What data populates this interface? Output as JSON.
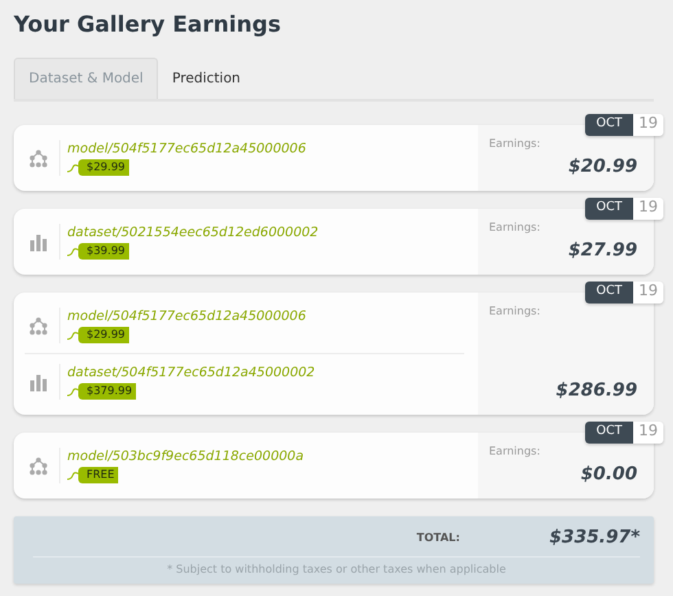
{
  "title": "Your Gallery Earnings",
  "tabs": [
    {
      "label": "Dataset & Model",
      "selected": true
    },
    {
      "label": "Prediction",
      "selected": false
    }
  ],
  "earnings": [
    {
      "date": {
        "month": "OCT",
        "day": "19"
      },
      "items": [
        {
          "kind": "model",
          "name": "model/504f5177ec65d12a45000006",
          "price": "$29.99"
        }
      ],
      "label": "Earnings:",
      "amount": "$20.99"
    },
    {
      "date": {
        "month": "OCT",
        "day": "19"
      },
      "items": [
        {
          "kind": "dataset",
          "name": "dataset/5021554eec65d12ed6000002",
          "price": "$39.99"
        }
      ],
      "label": "Earnings:",
      "amount": "$27.99"
    },
    {
      "date": {
        "month": "OCT",
        "day": "19"
      },
      "items": [
        {
          "kind": "model",
          "name": "model/504f5177ec65d12a45000006",
          "price": "$29.99"
        },
        {
          "kind": "dataset",
          "name": "dataset/504f5177ec65d12a45000002",
          "price": "$379.99"
        }
      ],
      "label": "Earnings:",
      "amount": "$286.99"
    },
    {
      "date": {
        "month": "OCT",
        "day": "19"
      },
      "items": [
        {
          "kind": "model",
          "name": "model/503bc9f9ec65d118ce00000a",
          "price": "FREE"
        }
      ],
      "label": "Earnings:",
      "amount": "$0.00"
    }
  ],
  "total": {
    "label": "TOTAL:",
    "amount": "$335.97*",
    "note": "* Subject to withholding taxes or other taxes when applicable"
  }
}
